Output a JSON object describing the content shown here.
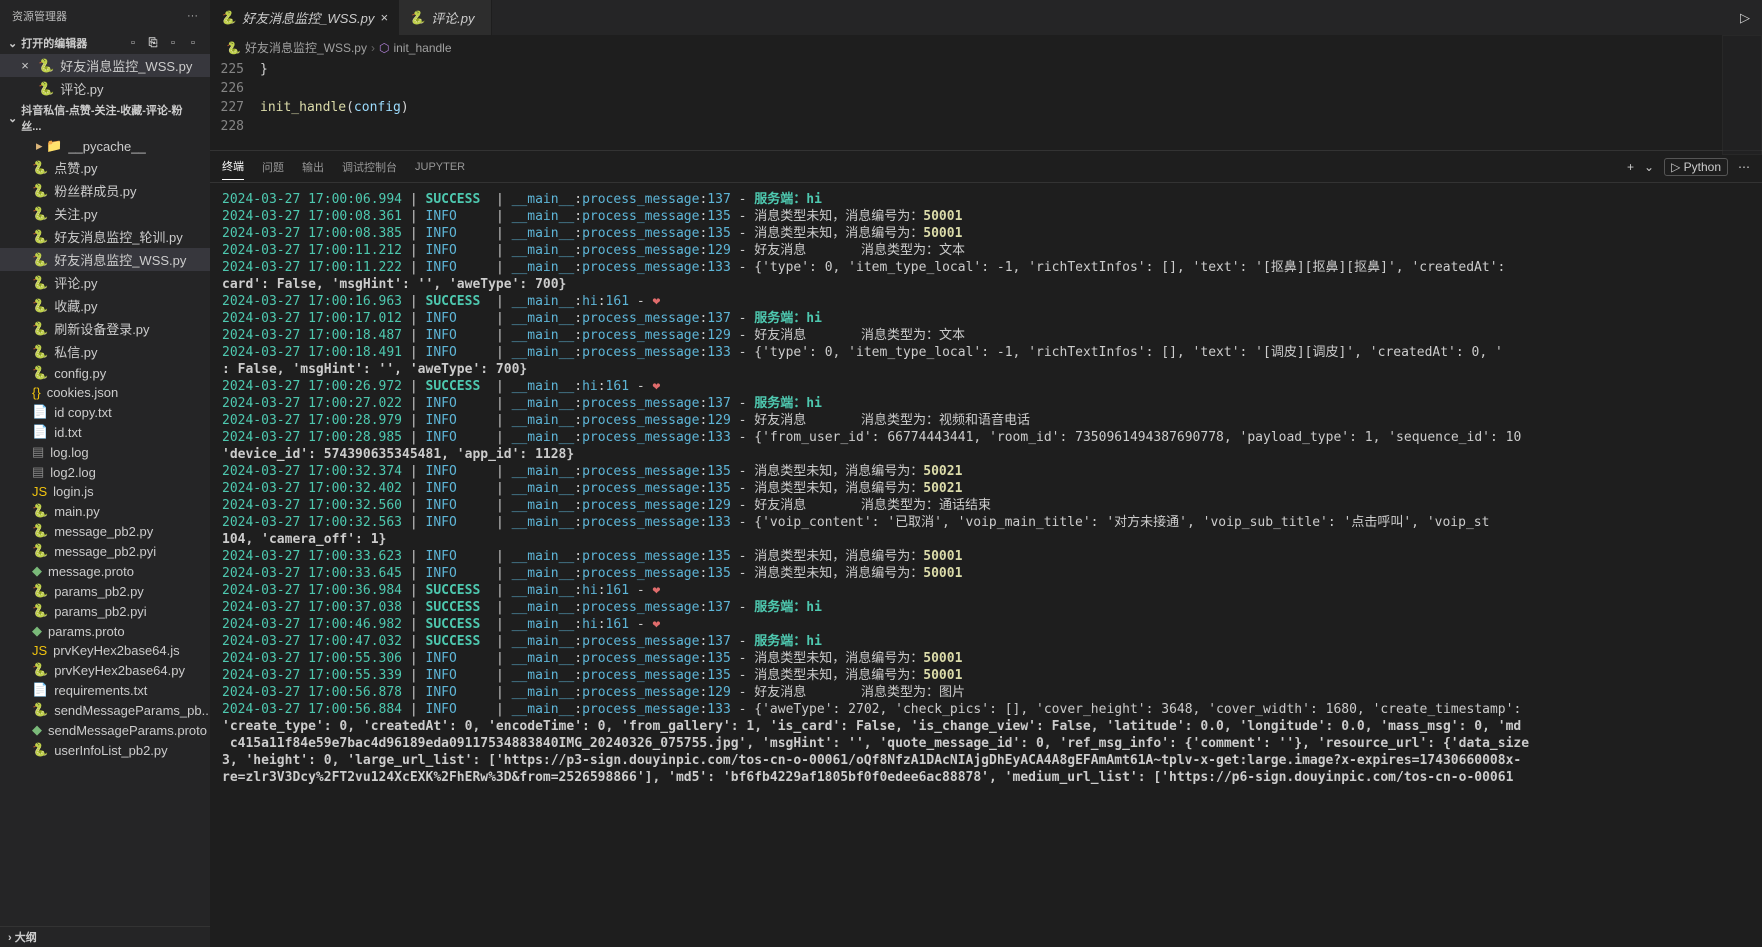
{
  "sidebar": {
    "title": "资源管理器",
    "more": "···",
    "sections": {
      "open_editors": "打开的编辑器",
      "project": "抖音私信-点赞-关注-收藏-评论-粉丝...",
      "outline": "大纲"
    },
    "open_editors_list": [
      {
        "name": "好友消息监控_WSS.py",
        "icon": "py",
        "active": true
      },
      {
        "name": "评论.py",
        "icon": "py",
        "active": false
      }
    ],
    "files": [
      {
        "name": "__pycache__",
        "icon": "folder",
        "indent": 1
      },
      {
        "name": "点赞.py",
        "icon": "py"
      },
      {
        "name": "粉丝群成员.py",
        "icon": "py"
      },
      {
        "name": "关注.py",
        "icon": "py"
      },
      {
        "name": "好友消息监控_轮训.py",
        "icon": "py"
      },
      {
        "name": "好友消息监控_WSS.py",
        "icon": "py",
        "active": true
      },
      {
        "name": "评论.py",
        "icon": "py"
      },
      {
        "name": "收藏.py",
        "icon": "py"
      },
      {
        "name": "刷新设备登录.py",
        "icon": "py"
      },
      {
        "name": "私信.py",
        "icon": "py"
      },
      {
        "name": "config.py",
        "icon": "py"
      },
      {
        "name": "cookies.json",
        "icon": "json"
      },
      {
        "name": "id copy.txt",
        "icon": "txt"
      },
      {
        "name": "id.txt",
        "icon": "txt"
      },
      {
        "name": "log.log",
        "icon": "log"
      },
      {
        "name": "log2.log",
        "icon": "log"
      },
      {
        "name": "login.js",
        "icon": "js"
      },
      {
        "name": "main.py",
        "icon": "py"
      },
      {
        "name": "message_pb2.py",
        "icon": "py"
      },
      {
        "name": "message_pb2.pyi",
        "icon": "py"
      },
      {
        "name": "message.proto",
        "icon": "proto"
      },
      {
        "name": "params_pb2.py",
        "icon": "py"
      },
      {
        "name": "params_pb2.pyi",
        "icon": "py"
      },
      {
        "name": "params.proto",
        "icon": "proto"
      },
      {
        "name": "prvKeyHex2base64.js",
        "icon": "js"
      },
      {
        "name": "prvKeyHex2base64.py",
        "icon": "py"
      },
      {
        "name": "requirements.txt",
        "icon": "txt"
      },
      {
        "name": "sendMessageParams_pb...",
        "icon": "py"
      },
      {
        "name": "sendMessageParams.proto",
        "icon": "proto"
      },
      {
        "name": "userInfoList_pb2.py",
        "icon": "py"
      }
    ]
  },
  "tabs": [
    {
      "name": "好友消息监控_WSS.py",
      "active": true
    },
    {
      "name": "评论.py",
      "active": false
    }
  ],
  "breadcrumb": {
    "file": "好友消息监控_WSS.py",
    "symbol": "init_handle"
  },
  "code": {
    "lines": [
      "225",
      "226",
      "227",
      "228"
    ],
    "brace": "}",
    "call_func": "init_handle",
    "call_arg": "config"
  },
  "terminal": {
    "tabs": [
      "终端",
      "问题",
      "输出",
      "调试控制台",
      "JUPYTER"
    ],
    "active_tab": "终端",
    "lang": "Python",
    "plus": "+",
    "logs": [
      {
        "ts": "2024-03-27 17:00:06.994",
        "lvl": "SUCCESS",
        "mod": "__main__",
        "fn": "process_message",
        "ln": "137",
        "msg": "服务端：hi",
        "type": "server"
      },
      {
        "ts": "2024-03-27 17:00:08.361",
        "lvl": "INFO",
        "mod": "__main__",
        "fn": "process_message",
        "ln": "135",
        "msg": "消息类型未知，消息编号为：",
        "num": "50001",
        "type": "unknown"
      },
      {
        "ts": "2024-03-27 17:00:08.385",
        "lvl": "INFO",
        "mod": "__main__",
        "fn": "process_message",
        "ln": "135",
        "msg": "消息类型未知，消息编号为：",
        "num": "50001",
        "type": "unknown"
      },
      {
        "ts": "2024-03-27 17:00:11.212",
        "lvl": "INFO",
        "mod": "__main__",
        "fn": "process_message",
        "ln": "129",
        "msg": "好友消息       消息类型为：文本",
        "type": "friend"
      },
      {
        "ts": "2024-03-27 17:00:11.222",
        "lvl": "INFO",
        "mod": "__main__",
        "fn": "process_message",
        "ln": "133",
        "msg": "{'type': 0, 'item_type_local': -1, 'richTextInfos': [], 'text': '[抠鼻][抠鼻][抠鼻]', 'createdAt':",
        "type": "dict"
      },
      {
        "wrap": "card': False, 'msgHint': '', 'aweType': 700}"
      },
      {
        "ts": "2024-03-27 17:00:16.963",
        "lvl": "SUCCESS",
        "mod": "__main__",
        "fn": "hi",
        "ln": "161",
        "msg": "❤",
        "type": "heart"
      },
      {
        "ts": "2024-03-27 17:00:17.012",
        "lvl": "INFO",
        "mod": "__main__",
        "fn": "process_message",
        "ln": "137",
        "msg": "服务端：hi",
        "type": "server"
      },
      {
        "ts": "2024-03-27 17:00:18.487",
        "lvl": "INFO",
        "mod": "__main__",
        "fn": "process_message",
        "ln": "129",
        "msg": "好友消息       消息类型为：文本",
        "type": "friend"
      },
      {
        "ts": "2024-03-27 17:00:18.491",
        "lvl": "INFO",
        "mod": "__main__",
        "fn": "process_message",
        "ln": "133",
        "msg": "{'type': 0, 'item_type_local': -1, 'richTextInfos': [], 'text': '[调皮][调皮]', 'createdAt': 0, '",
        "type": "dict"
      },
      {
        "wrap": ": False, 'msgHint': '', 'aweType': 700}"
      },
      {
        "ts": "2024-03-27 17:00:26.972",
        "lvl": "SUCCESS",
        "mod": "__main__",
        "fn": "hi",
        "ln": "161",
        "msg": "❤",
        "type": "heart"
      },
      {
        "ts": "2024-03-27 17:00:27.022",
        "lvl": "INFO",
        "mod": "__main__",
        "fn": "process_message",
        "ln": "137",
        "msg": "服务端：hi",
        "type": "server"
      },
      {
        "ts": "2024-03-27 17:00:28.979",
        "lvl": "INFO",
        "mod": "__main__",
        "fn": "process_message",
        "ln": "129",
        "msg": "好友消息       消息类型为：视频和语音电话",
        "type": "friend"
      },
      {
        "ts": "2024-03-27 17:00:28.985",
        "lvl": "INFO",
        "mod": "__main__",
        "fn": "process_message",
        "ln": "133",
        "msg": "{'from_user_id': 66774443441, 'room_id': 7350961494387690778, 'payload_type': 1, 'sequence_id': 10",
        "type": "dict"
      },
      {
        "wrap": "'device_id': 574390635345481, 'app_id': 1128}"
      },
      {
        "ts": "2024-03-27 17:00:32.374",
        "lvl": "INFO",
        "mod": "__main__",
        "fn": "process_message",
        "ln": "135",
        "msg": "消息类型未知，消息编号为：",
        "num": "50021",
        "type": "unknown"
      },
      {
        "ts": "2024-03-27 17:00:32.402",
        "lvl": "INFO",
        "mod": "__main__",
        "fn": "process_message",
        "ln": "135",
        "msg": "消息类型未知，消息编号为：",
        "num": "50021",
        "type": "unknown"
      },
      {
        "ts": "2024-03-27 17:00:32.560",
        "lvl": "INFO",
        "mod": "__main__",
        "fn": "process_message",
        "ln": "129",
        "msg": "好友消息       消息类型为：通话结束",
        "type": "friend"
      },
      {
        "ts": "2024-03-27 17:00:32.563",
        "lvl": "INFO",
        "mod": "__main__",
        "fn": "process_message",
        "ln": "133",
        "msg": "{'voip_content': '已取消', 'voip_main_title': '对方未接通', 'voip_sub_title': '点击呼叫', 'voip_st",
        "type": "dict"
      },
      {
        "wrap": "104, 'camera_off': 1}"
      },
      {
        "ts": "2024-03-27 17:00:33.623",
        "lvl": "INFO",
        "mod": "__main__",
        "fn": "process_message",
        "ln": "135",
        "msg": "消息类型未知，消息编号为：",
        "num": "50001",
        "type": "unknown"
      },
      {
        "ts": "2024-03-27 17:00:33.645",
        "lvl": "INFO",
        "mod": "__main__",
        "fn": "process_message",
        "ln": "135",
        "msg": "消息类型未知，消息编号为：",
        "num": "50001",
        "type": "unknown"
      },
      {
        "ts": "2024-03-27 17:00:36.984",
        "lvl": "SUCCESS",
        "mod": "__main__",
        "fn": "hi",
        "ln": "161",
        "msg": "❤",
        "type": "heart"
      },
      {
        "ts": "2024-03-27 17:00:37.038",
        "lvl": "SUCCESS",
        "mod": "__main__",
        "fn": "process_message",
        "ln": "137",
        "msg": "服务端：hi",
        "type": "server"
      },
      {
        "ts": "2024-03-27 17:00:46.982",
        "lvl": "SUCCESS",
        "mod": "__main__",
        "fn": "hi",
        "ln": "161",
        "msg": "❤",
        "type": "heart"
      },
      {
        "ts": "2024-03-27 17:00:47.032",
        "lvl": "SUCCESS",
        "mod": "__main__",
        "fn": "process_message",
        "ln": "137",
        "msg": "服务端：hi",
        "type": "server"
      },
      {
        "ts": "2024-03-27 17:00:55.306",
        "lvl": "INFO",
        "mod": "__main__",
        "fn": "process_message",
        "ln": "135",
        "msg": "消息类型未知，消息编号为：",
        "num": "50001",
        "type": "unknown"
      },
      {
        "ts": "2024-03-27 17:00:55.339",
        "lvl": "INFO",
        "mod": "__main__",
        "fn": "process_message",
        "ln": "135",
        "msg": "消息类型未知，消息编号为：",
        "num": "50001",
        "type": "unknown"
      },
      {
        "ts": "2024-03-27 17:00:56.878",
        "lvl": "INFO",
        "mod": "__main__",
        "fn": "process_message",
        "ln": "129",
        "msg": "好友消息       消息类型为：图片",
        "type": "friend"
      },
      {
        "ts": "2024-03-27 17:00:56.884",
        "lvl": "INFO",
        "mod": "__main__",
        "fn": "process_message",
        "ln": "133",
        "msg": "{'aweType': 2702, 'check_pics': [], 'cover_height': 3648, 'cover_width': 1680, 'create_timestamp':",
        "type": "dict"
      },
      {
        "wrap": "'create_type': 0, 'createdAt': 0, 'encodeTime': 0, 'from_gallery': 1, 'is_card': False, 'is_change_view': False, 'latitude': 0.0, 'longitude': 0.0, 'mass_msg': 0, 'md"
      },
      {
        "wrap": " c415a11f84e59e7bac4d96189eda09117534883840IMG_20240326_075755.jpg', 'msgHint': '', 'quote_message_id': 0, 'ref_msg_info': {'comment': ''}, 'resource_url': {'data_size"
      },
      {
        "wrap": "3, 'height': 0, 'large_url_list': ['https://p3-sign.douyinpic.com/tos-cn-o-00061/oQf8NfzA1DAcNIAjgDhEyACA4A8gEFAmAmt61A~tplv-x-get:large.image?x-expires=17430660008x-"
      },
      {
        "wrap": "re=zlr3V3Dcy%2FT2vu124XcEXK%2FhERw%3D&from=2526598866'], 'md5': 'bf6fb4229af1805bf0f0edee6ac88878', 'medium_url_list': ['https://p6-sign.douyinpic.com/tos-cn-o-00061"
      }
    ]
  }
}
